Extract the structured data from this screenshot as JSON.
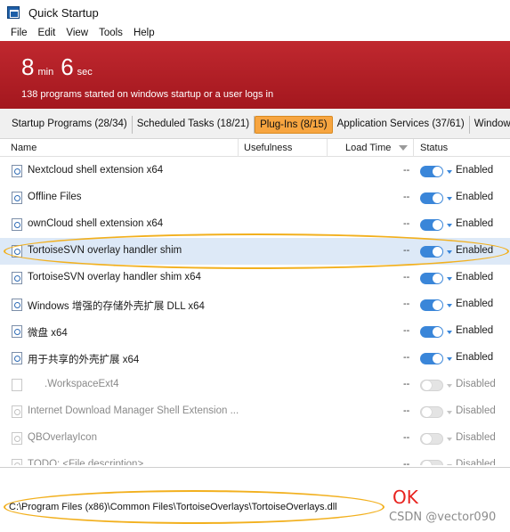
{
  "window": {
    "title": "Quick Startup"
  },
  "menu": [
    "File",
    "Edit",
    "View",
    "Tools",
    "Help"
  ],
  "banner": {
    "minutes": "8",
    "min_unit": "min",
    "seconds": "6",
    "sec_unit": "sec",
    "subtitle": "138 programs started on windows startup or a user logs in"
  },
  "tabs": [
    {
      "label": "Startup Programs (28/34)",
      "active": false
    },
    {
      "label": "Scheduled Tasks (18/21)",
      "active": false
    },
    {
      "label": "Plug-Ins (8/15)",
      "active": true
    },
    {
      "label": "Application Services (37/61)",
      "active": false
    },
    {
      "label": "Windows Servi",
      "active": false
    }
  ],
  "columns": {
    "name": "Name",
    "usefulness": "Usefulness",
    "load_time": "Load Time",
    "status": "Status"
  },
  "rows": [
    {
      "name": "Nextcloud shell extension x64",
      "load": "--",
      "status": "Enabled",
      "enabled": true,
      "selected": false
    },
    {
      "name": "Offline Files",
      "load": "--",
      "status": "Enabled",
      "enabled": true,
      "selected": false
    },
    {
      "name": "ownCloud shell extension x64",
      "load": "--",
      "status": "Enabled",
      "enabled": true,
      "selected": false
    },
    {
      "name": "TortoiseSVN overlay handler shim",
      "load": "--",
      "status": "Enabled",
      "enabled": true,
      "selected": true
    },
    {
      "name": "TortoiseSVN overlay handler shim x64",
      "load": "--",
      "status": "Enabled",
      "enabled": true,
      "selected": false
    },
    {
      "name": "Windows 增强的存储外壳扩展 DLL x64",
      "load": "--",
      "status": "Enabled",
      "enabled": true,
      "selected": false
    },
    {
      "name": "微盘 x64",
      "load": "--",
      "status": "Enabled",
      "enabled": true,
      "selected": false
    },
    {
      "name": "用于共享的外壳扩展 x64",
      "load": "--",
      "status": "Enabled",
      "enabled": true,
      "selected": false
    },
    {
      "name": ".WorkspaceExt4",
      "load": "--",
      "status": "Disabled",
      "enabled": false,
      "selected": false
    },
    {
      "name": "Internet Download Manager Shell Extension ...",
      "load": "--",
      "status": "Disabled",
      "enabled": false,
      "selected": false
    },
    {
      "name": "QBOverlayIcon",
      "load": "--",
      "status": "Disabled",
      "enabled": false,
      "selected": false
    },
    {
      "name": "TODO: <File description>",
      "load": "--",
      "status": "Disabled",
      "enabled": false,
      "selected": false
    }
  ],
  "path": "C:\\Program Files (x86)\\Common Files\\TortoiseOverlays\\TortoiseOverlays.dll",
  "annotation": {
    "ok": "OK",
    "color": "#e8231f",
    "ellipse_color": "#f2b01e"
  },
  "watermark": "CSDN @vector090",
  "colors": {
    "banner": "#b31f26",
    "active_tab": "#f7a540",
    "toggle_on": "#3a86d9"
  }
}
